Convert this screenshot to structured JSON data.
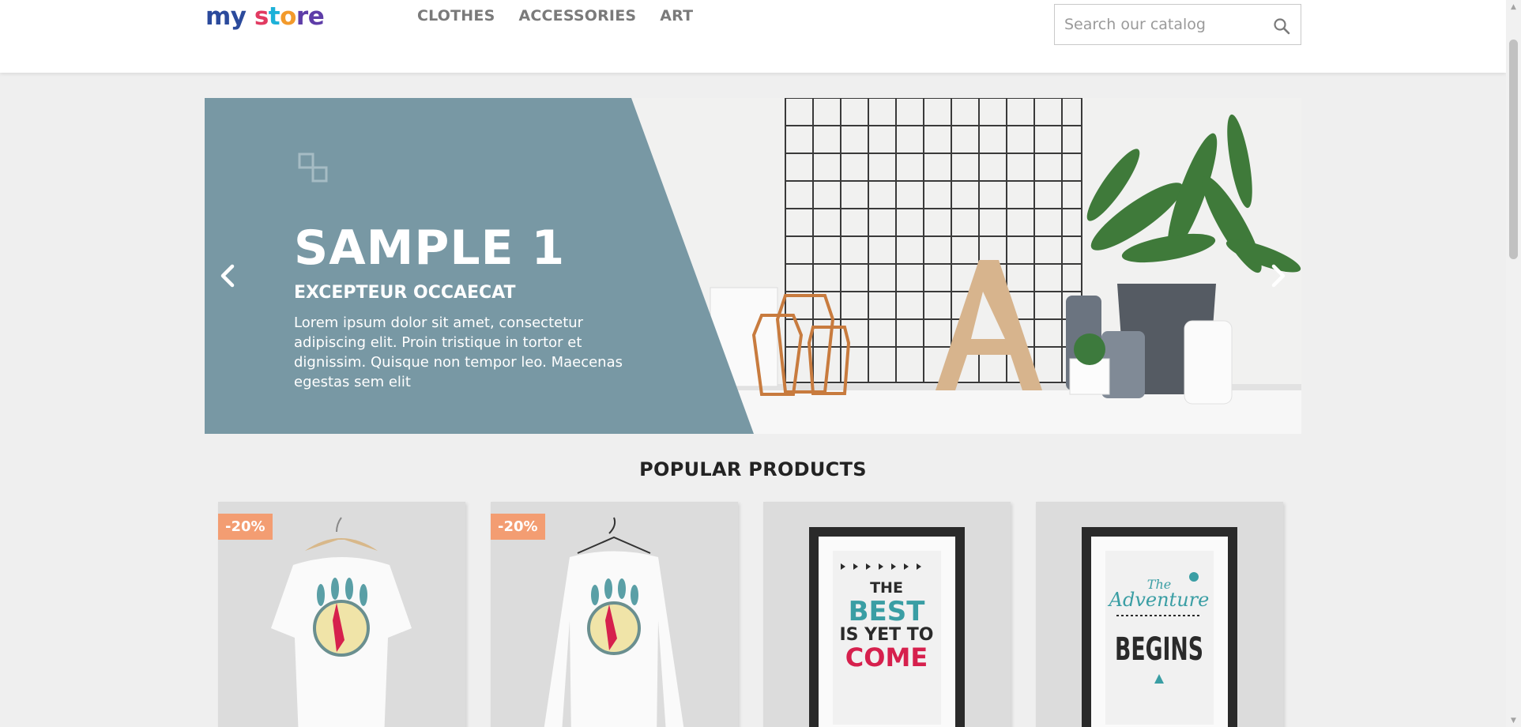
{
  "header": {
    "logo": {
      "part1": "my ",
      "part2": "s",
      "part3": "t",
      "part4": "o",
      "part5": "re"
    },
    "nav": [
      {
        "label": "CLOTHES"
      },
      {
        "label": "ACCESSORIES"
      },
      {
        "label": "ART"
      }
    ],
    "search": {
      "placeholder": "Search our catalog",
      "icon": "search-icon"
    }
  },
  "slider": {
    "title": "SAMPLE 1",
    "subtitle": "EXCEPTEUR OCCAECAT",
    "description": "Lorem ipsum dolor sit amet, consectetur adipiscing elit. Proin tristique in tortor et dignissim. Quisque non tempor leo. Maecenas egestas sem elit",
    "prev_icon": "chevron-left-icon",
    "next_icon": "chevron-right-icon",
    "panel_color": "#7898a4"
  },
  "popular": {
    "title": "POPULAR PRODUCTS",
    "products": [
      {
        "badge": "-20%",
        "image": "tshirt-hummingbird"
      },
      {
        "badge": "-20%",
        "image": "sweater-hummingbird"
      },
      {
        "badge": "",
        "image": "poster-best-is-yet-to-come"
      },
      {
        "badge": "",
        "image": "poster-adventure-begins"
      }
    ]
  },
  "colors": {
    "badge": "#f39d72",
    "nav_text": "#7a7a7a",
    "page_bg": "#efefef"
  }
}
